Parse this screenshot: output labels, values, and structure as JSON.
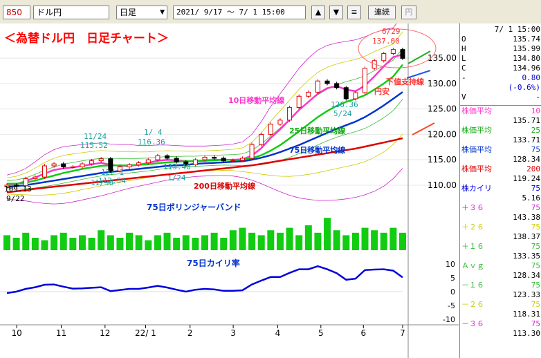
{
  "toolbar": {
    "code": "850",
    "name": "ドル円",
    "period": "日足",
    "dropdown_arrow": "▼",
    "range_start": "2021/ 9/17",
    "range_sep": "～",
    "range_end": "7/ 1 15:00",
    "up_arrow": "▲",
    "down_arrow": "▼",
    "menu_glyph": "≡",
    "renzoku_label": "連続",
    "yen_label": "円"
  },
  "colors": {
    "candle_up": "#dd0000",
    "candle_down": "#000000",
    "ma10": "#ff33cc",
    "ma25": "#11cc11",
    "ma75": "#0033cc",
    "ma200": "#dd0000",
    "bollinger_3": "#cc22cc",
    "bollinger_2": "#cccc00",
    "bollinger_1": "#33bb33",
    "volume": "#11cc11",
    "kairi": "#0000dd",
    "title_red": "#ff0000"
  },
  "chart_data": {
    "type": "candlestick",
    "title": "＜為替ドル円　日足チャート＞",
    "x_tick_labels": [
      "10",
      "11",
      "12",
      "22/ 1",
      "2",
      "3",
      "4",
      "5",
      "6",
      "7"
    ],
    "y_tick_labels": [
      "135.00",
      "130.00",
      "125.00",
      "120.00",
      "115.00",
      "110.00"
    ],
    "ylim": [
      107,
      141
    ],
    "kairi_tick_labels": [
      "10",
      "5",
      "0",
      "-5",
      "-10"
    ],
    "kairi_ylim": [
      -12,
      12
    ],
    "dates": [
      "9/17",
      "9/22",
      "9/30",
      "10/7",
      "10/14",
      "10/21",
      "10/28",
      "11/4",
      "11/11",
      "11/18",
      "11/24",
      "12/1",
      "12/8",
      "12/15",
      "12/22",
      "12/29",
      "1/4",
      "1/11",
      "1/18",
      "1/24",
      "2/1",
      "2/8",
      "2/15",
      "2/22",
      "3/1",
      "3/7",
      "3/14",
      "3/21",
      "3/28",
      "4/4",
      "4/11",
      "4/18",
      "4/25",
      "5/2",
      "5/9",
      "5/16",
      "5/24",
      "5/31",
      "6/7",
      "6/14",
      "6/21",
      "6/29",
      "7/1"
    ],
    "close": [
      110.0,
      109.9,
      111.3,
      111.6,
      113.8,
      114.2,
      113.6,
      113.6,
      114.2,
      114.8,
      115.2,
      112.8,
      113.6,
      114.0,
      114.4,
      115.0,
      115.8,
      115.3,
      114.6,
      114.0,
      115.0,
      115.5,
      115.3,
      114.8,
      114.9,
      115.3,
      118.0,
      120.0,
      122.0,
      122.8,
      125.3,
      127.5,
      128.3,
      130.5,
      130.0,
      129.2,
      127.0,
      128.2,
      133.0,
      134.5,
      135.9,
      136.7,
      134.96
    ],
    "ma_series": [
      {
        "name": "10日移動平均線",
        "values": [
          109.8,
          110.2,
          110.8,
          111.5,
          112.3,
          113.0,
          113.3,
          113.5,
          113.8,
          114.1,
          114.4,
          114.0,
          113.8,
          113.8,
          114.0,
          114.4,
          114.8,
          115.0,
          114.9,
          114.7,
          114.7,
          114.9,
          115.0,
          115.0,
          115.0,
          115.1,
          115.8,
          117.3,
          119.3,
          121.0,
          122.9,
          124.8,
          126.4,
          128.0,
          129.1,
          129.5,
          128.8,
          128.5,
          129.6,
          131.4,
          133.4,
          135.2,
          135.71
        ]
      },
      {
        "name": "25日移動平均線",
        "values": [
          110.3,
          110.3,
          110.5,
          110.9,
          111.4,
          111.9,
          112.4,
          112.8,
          113.2,
          113.5,
          113.8,
          113.9,
          113.9,
          113.9,
          114.0,
          114.1,
          114.3,
          114.5,
          114.6,
          114.7,
          114.7,
          114.8,
          114.9,
          115.0,
          115.0,
          115.0,
          115.3,
          115.9,
          116.8,
          117.9,
          119.2,
          120.6,
          122.0,
          123.4,
          124.6,
          125.6,
          126.4,
          127.0,
          127.7,
          128.8,
          130.0,
          131.4,
          133.71
        ]
      },
      {
        "name": "75日移動平均線",
        "values": [
          109.6,
          109.8,
          110.0,
          110.3,
          110.6,
          110.9,
          111.2,
          111.5,
          111.8,
          112.1,
          112.4,
          112.6,
          112.8,
          113.0,
          113.2,
          113.4,
          113.6,
          113.8,
          113.9,
          114.0,
          114.2,
          114.3,
          114.4,
          114.5,
          114.6,
          114.7,
          115.0,
          115.4,
          115.9,
          116.5,
          117.2,
          117.9,
          118.7,
          119.5,
          120.3,
          121.1,
          121.8,
          122.5,
          123.4,
          124.5,
          125.7,
          127.0,
          128.34
        ]
      },
      {
        "name": "200日移動平均線",
        "values": [
          108.6,
          108.8,
          109.0,
          109.3,
          109.5,
          109.7,
          109.9,
          110.1,
          110.3,
          110.5,
          110.7,
          110.9,
          111.1,
          111.3,
          111.5,
          111.7,
          111.9,
          112.1,
          112.3,
          112.5,
          112.7,
          112.9,
          113.1,
          113.3,
          113.5,
          113.7,
          113.9,
          114.2,
          114.5,
          114.8,
          115.1,
          115.4,
          115.7,
          116.0,
          116.3,
          116.6,
          116.9,
          117.2,
          117.6,
          118.0,
          118.4,
          118.8,
          119.24
        ]
      }
    ],
    "bollinger_plus3": [
      112.0,
      112.5,
      113.3,
      114.6,
      116.0,
      117.0,
      117.6,
      117.8,
      118.0,
      118.2,
      118.3,
      118.1,
      118.0,
      118.0,
      117.8,
      117.8,
      117.9,
      117.9,
      117.8,
      117.7,
      117.7,
      117.7,
      117.8,
      117.9,
      118.1,
      118.5,
      120.0,
      122.5,
      125.5,
      128.0,
      130.5,
      133.0,
      135.0,
      136.6,
      137.5,
      138.0,
      138.3,
      138.6,
      139.2,
      140.0,
      140.6,
      141.0,
      143.38
    ],
    "bollinger_minus3": [
      107.2,
      107.1,
      106.9,
      106.6,
      106.4,
      106.3,
      106.4,
      106.7,
      107.1,
      107.5,
      107.9,
      108.4,
      108.9,
      109.4,
      109.8,
      110.2,
      110.6,
      111.0,
      111.3,
      111.5,
      111.7,
      111.8,
      111.9,
      111.9,
      111.8,
      111.5,
      111.0,
      110.3,
      109.5,
      108.7,
      108.0,
      107.5,
      107.2,
      107.0,
      107.0,
      107.1,
      107.3,
      107.6,
      108.1,
      108.8,
      109.8,
      111.3,
      113.3
    ],
    "annotations": [
      {
        "text": "6/29",
        "price": "137.00"
      },
      {
        "text": "5/24",
        "price": "126.36"
      },
      {
        "text": "1/ 4",
        "price": "116.36"
      },
      {
        "text": "11/24",
        "price": "115.52"
      },
      {
        "text": "12/ 1",
        "price": "112.54"
      },
      {
        "text": "11/30",
        "price": ""
      },
      {
        "text": "1/24",
        "price": "113.48"
      },
      {
        "text": "9/22",
        "price": "109.13"
      }
    ],
    "volume": [
      6,
      5,
      7,
      5,
      4,
      6,
      7,
      5,
      6,
      5,
      8,
      6,
      5,
      7,
      6,
      4,
      6,
      7,
      5,
      6,
      5,
      6,
      7,
      5,
      8,
      9,
      7,
      6,
      8,
      7,
      9,
      6,
      10,
      7,
      13,
      8,
      6,
      7,
      9,
      8,
      7,
      9,
      7
    ],
    "kairi": [
      -0.5,
      0.0,
      1.0,
      1.6,
      2.5,
      2.6,
      1.8,
      1.1,
      1.2,
      1.4,
      1.6,
      0.2,
      0.6,
      1.0,
      1.0,
      1.5,
      2.1,
      1.5,
      0.7,
      0.0,
      0.7,
      1.0,
      0.8,
      0.3,
      0.3,
      0.5,
      2.6,
      4.0,
      5.3,
      5.3,
      6.8,
      8.1,
      8.1,
      9.2,
      8.1,
      6.7,
      4.3,
      4.7,
      7.8,
      8.0,
      8.1,
      7.6,
      5.16
    ]
  },
  "labels": {
    "title": "＜為替ドル円　日足チャート＞",
    "ma10": "10日移動平均線",
    "ma25": "25日移動平均線",
    "ma75": "75日移動平均線",
    "ma200": "200日移動平均線",
    "boll": "75日ボリンジャーバンド",
    "kairi": "75日カイリ率",
    "support": "下値支持線",
    "yenyasu": "円安"
  },
  "ann_text": {
    "a1_date": "6/29",
    "a1_price": "137.00",
    "a2_price": "126.36",
    "a2_date": "5/24",
    "a3_date": "1/ 4",
    "a3_price": "116.36",
    "a4_date": "11/24",
    "a4_price": "115.52",
    "a5_date": "12/ 1",
    "a5_price": "112.54",
    "a6_date": "11/30",
    "a7_price": "113.48",
    "a7_date": "1/24",
    "a8_price": "109.13",
    "a8_date": "9/22"
  },
  "panel": {
    "datetime": "7/ 1 15:00",
    "ohlc": [
      {
        "k": "O",
        "v": "135.74"
      },
      {
        "k": "H",
        "v": "135.99"
      },
      {
        "k": "L",
        "v": "134.80"
      },
      {
        "k": "C",
        "v": "134.96"
      },
      {
        "k": "-",
        "v": "0.80"
      },
      {
        "k": "",
        "v": "(-0.6%)"
      },
      {
        "k": "V",
        "v": "-"
      }
    ],
    "indicators": [
      {
        "name": "株価平均",
        "param": "10",
        "value": "135.71",
        "color": "#ff33cc"
      },
      {
        "name": "株価平均",
        "param": "25",
        "value": "133.71",
        "color": "#11aa11"
      },
      {
        "name": "株価平均",
        "param": "75",
        "value": "128.34",
        "color": "#0033cc"
      },
      {
        "name": "株価平均",
        "param": "200",
        "value": "119.24",
        "color": "#dd0000"
      },
      {
        "name": "株カイリ",
        "param": "75",
        "value": "5.16",
        "color": "#0000dd"
      },
      {
        "name": "＋３６",
        "param": "75",
        "value": "143.38",
        "color": "#cc22cc"
      },
      {
        "name": "＋２６",
        "param": "75",
        "value": "138.37",
        "color": "#cccc00"
      },
      {
        "name": "＋１６",
        "param": "75",
        "value": "133.35",
        "color": "#33bb33"
      },
      {
        "name": "Ａｖｇ",
        "param": "75",
        "value": "128.34",
        "color": "#33bb33"
      },
      {
        "name": "－１６",
        "param": "75",
        "value": "123.33",
        "color": "#33bb33"
      },
      {
        "name": "－２６",
        "param": "75",
        "value": "118.31",
        "color": "#cccc00"
      },
      {
        "name": "－３６",
        "param": "75",
        "value": "113.30",
        "color": "#cc22cc"
      }
    ]
  }
}
